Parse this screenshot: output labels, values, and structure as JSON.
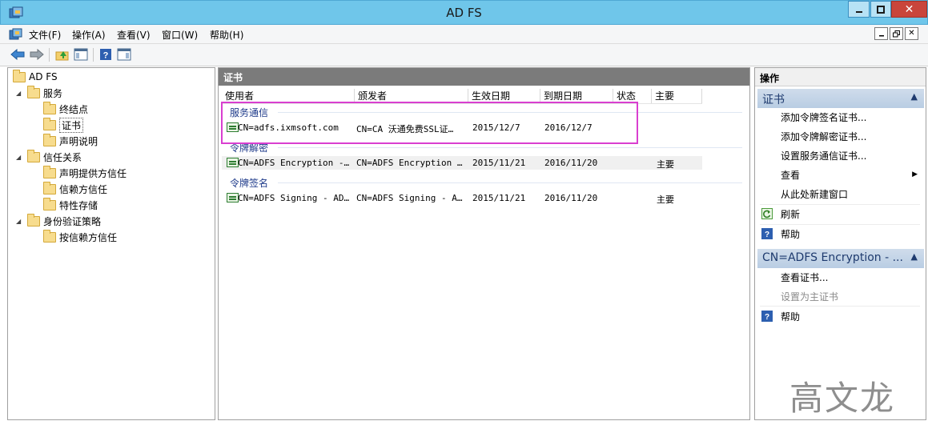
{
  "window": {
    "title": "AD FS",
    "app_icon": "adfs-icon",
    "controls": [
      "minimize",
      "maximize",
      "close"
    ]
  },
  "menu": {
    "items": [
      "文件(F)",
      "操作(A)",
      "查看(V)",
      "窗口(W)",
      "帮助(H)"
    ]
  },
  "toolbar": {
    "buttons": [
      "back-arrow-icon",
      "forward-arrow-icon",
      "up-folder-icon",
      "show-hide-tree-icon",
      "help-icon",
      "show-hide-action-pane-icon"
    ]
  },
  "tree": {
    "root": "AD FS",
    "service": {
      "label": "服务",
      "children": [
        "终结点",
        "证书",
        "声明说明"
      ]
    },
    "trust": {
      "label": "信任关系",
      "children": [
        "声明提供方信任",
        "信赖方信任",
        "特性存储"
      ]
    },
    "auth": {
      "label": "身份验证策略",
      "children": [
        "按信赖方信任"
      ]
    },
    "selected": "证书"
  },
  "center": {
    "header": "证书",
    "columns": [
      "使用者",
      "颁发者",
      "生效日期",
      "到期日期",
      "状态",
      "主要"
    ],
    "groups": [
      {
        "name": "服务通信",
        "rows": [
          {
            "subject": "CN=adfs.ixmsoft.com",
            "issuer": "CN=CA 沃通免费SSL证…",
            "effective": "2015/12/7",
            "expiry": "2016/12/7",
            "status": "",
            "primary": ""
          }
        ]
      },
      {
        "name": "令牌解密",
        "rows": [
          {
            "subject": "CN=ADFS Encryption -…",
            "issuer": "CN=ADFS Encryption …",
            "effective": "2015/11/21",
            "expiry": "2016/11/20",
            "status": "",
            "primary": "主要"
          }
        ]
      },
      {
        "name": "令牌签名",
        "rows": [
          {
            "subject": "CN=ADFS Signing - AD…",
            "issuer": "CN=ADFS Signing - A…",
            "effective": "2015/11/21",
            "expiry": "2016/11/20",
            "status": "",
            "primary": "主要"
          }
        ]
      }
    ],
    "highlight_color": "#d93fd0"
  },
  "actions": {
    "title": "操作",
    "section1": {
      "label": "证书",
      "items": [
        "添加令牌签名证书...",
        "添加令牌解密证书...",
        "设置服务通信证书...",
        "查看",
        "从此处新建窗口",
        "刷新",
        "帮助"
      ]
    },
    "section2": {
      "label": "CN=ADFS Encryption - ...",
      "items": [
        "查看证书...",
        "设置为主证书",
        "帮助"
      ]
    }
  },
  "watermark": "高文龙"
}
